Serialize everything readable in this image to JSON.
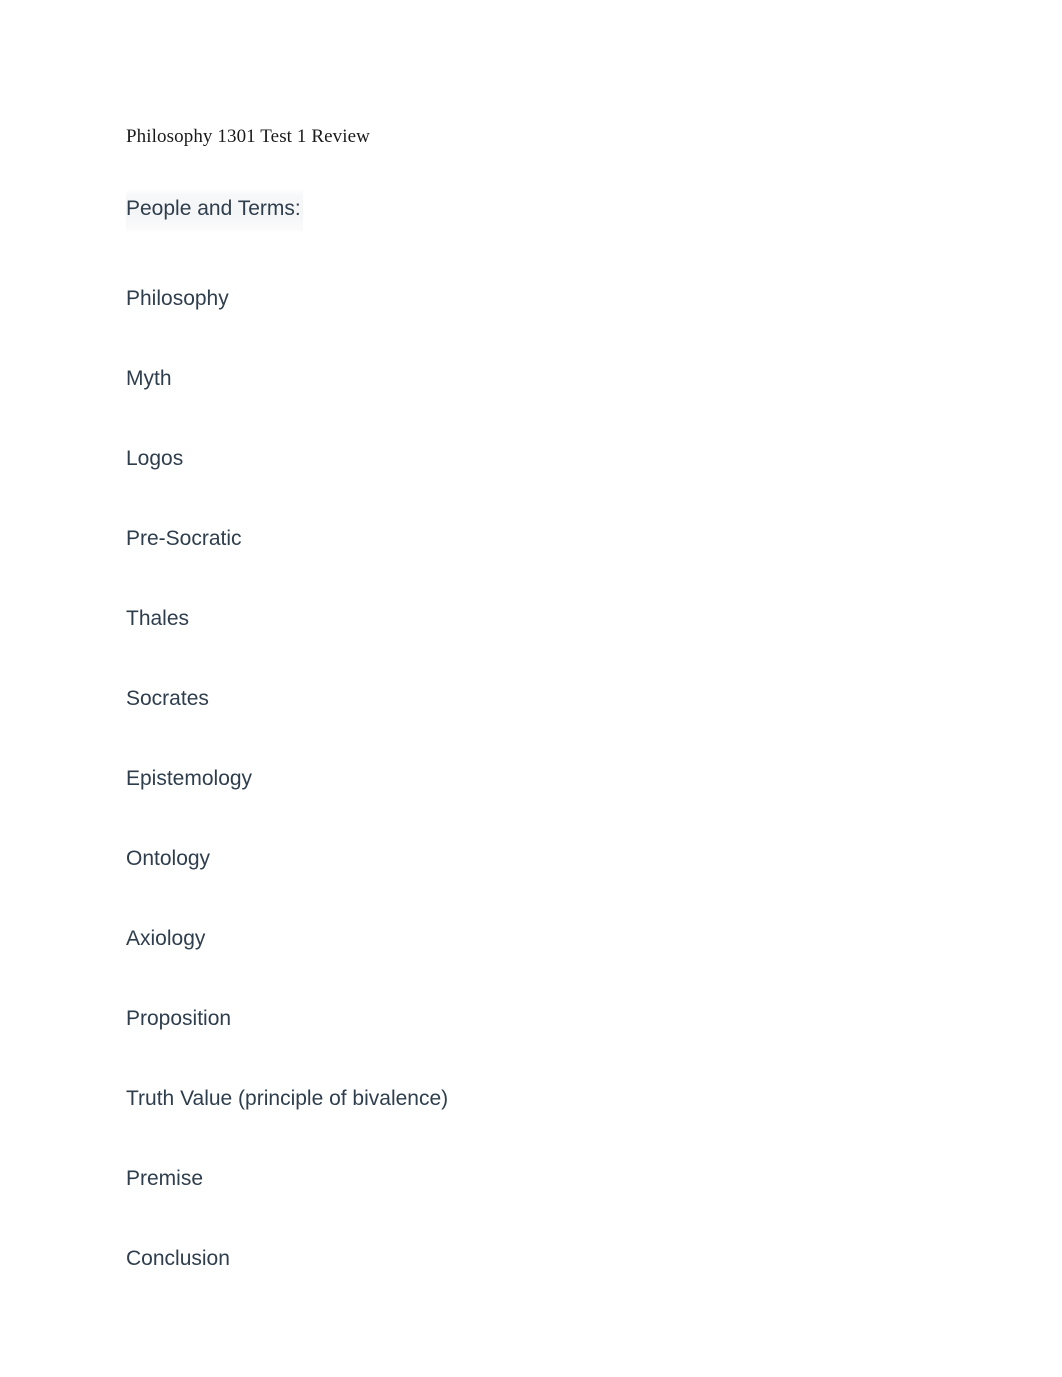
{
  "document": {
    "title": "Philosophy 1301 Test 1 Review",
    "section_heading": "People and Terms:",
    "terms": [
      {
        "label": "Philosophy"
      },
      {
        "label": "Myth"
      },
      {
        "label": "Logos"
      },
      {
        "label": "Pre-Socratic"
      },
      {
        "label": "Thales"
      },
      {
        "label": "Socrates"
      },
      {
        "label": "Epistemology"
      },
      {
        "label": "Ontology"
      },
      {
        "label": "Axiology"
      },
      {
        "label": "Proposition"
      },
      {
        "label": "Truth Value (principle of bivalence)"
      },
      {
        "label": "Premise"
      },
      {
        "label": "Conclusion"
      }
    ]
  },
  "colors": {
    "page_background": "#ffffff",
    "title_text": "#1a1a1a",
    "body_text": "#2f3e4d",
    "highlight_band": "#f4f5f6"
  }
}
